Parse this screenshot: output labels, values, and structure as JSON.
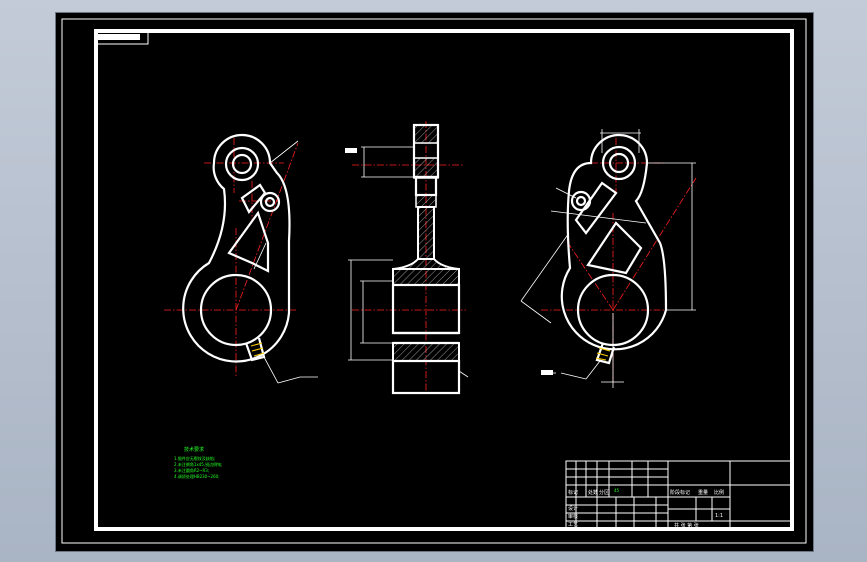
{
  "drawing": {
    "tech_notes_title": "技术要求",
    "tech_notes": [
      "1.锻件应无裂纹及缺陷;",
      "2.未注倒角1x45,锐边倒钝;",
      "3.未注圆角R2~R3;",
      "4.调质处理HB230~260;"
    ],
    "title_block": {
      "material": "45",
      "labels": [
        "标记",
        "处数",
        "分区",
        "设计",
        "审核",
        "工艺"
      ],
      "stage_label": "阶段标记",
      "weight_label": "重量",
      "scale_label": "比例",
      "scale_value": "1:1",
      "sheet_label": "共 张 第 张"
    }
  },
  "colors": {
    "frame": "#ffffff",
    "centerline": "#ff2020",
    "notes": "#22ff22",
    "highlight": "#ffd000"
  }
}
